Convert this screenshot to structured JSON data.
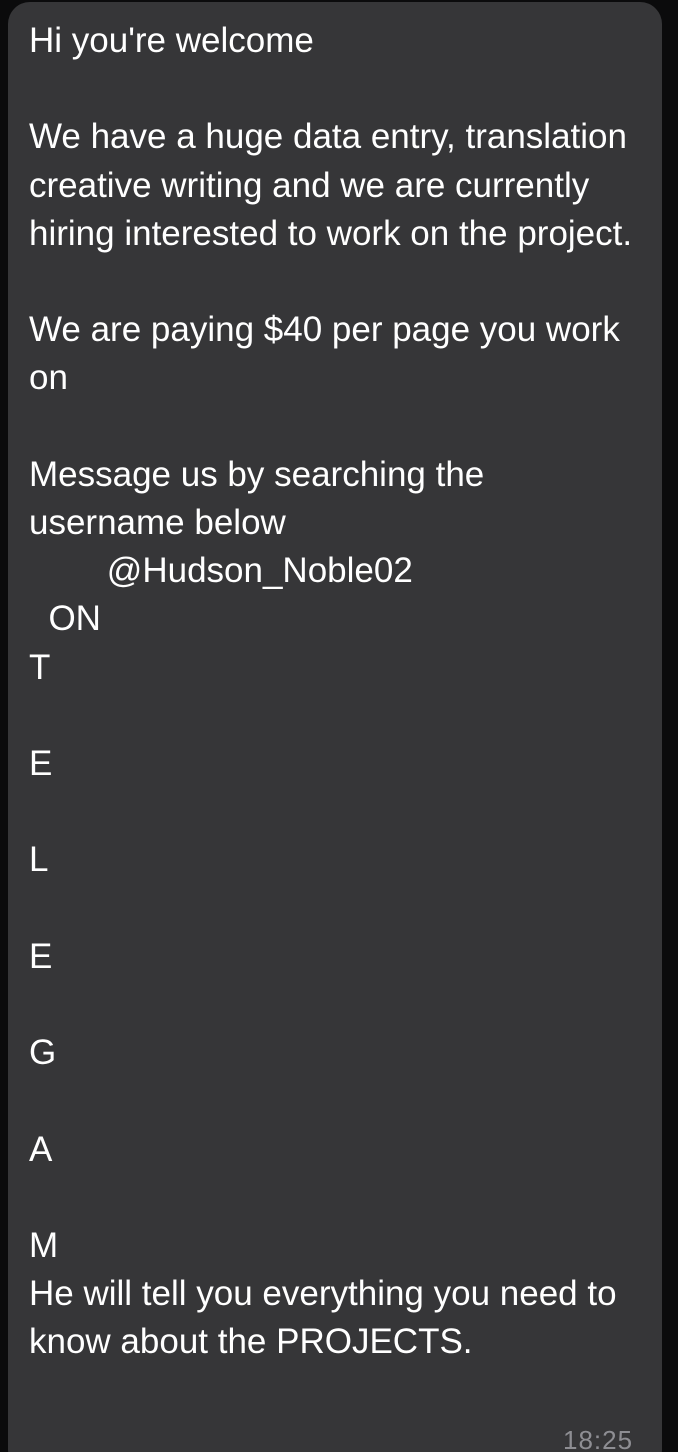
{
  "message": {
    "text": "Hi you're welcome\n\nWe have a huge data entry, translation creative writing and we are currently hiring interested to work on the project.\n\nWe are paying $40 per page you work on\n\nMessage us by searching the username below\n        @Hudson_Noble02\n  ON\nT\n\nE\n\nL\n\nE\n\nG\n\nA\n\nM\nHe will tell you everything you need to know about the PROJECTS.",
    "time": "18:25"
  },
  "colors": {
    "bubble": "#363638",
    "text": "#ffffff",
    "timestamp": "#8e8e93",
    "background": "#0b0b0c"
  }
}
